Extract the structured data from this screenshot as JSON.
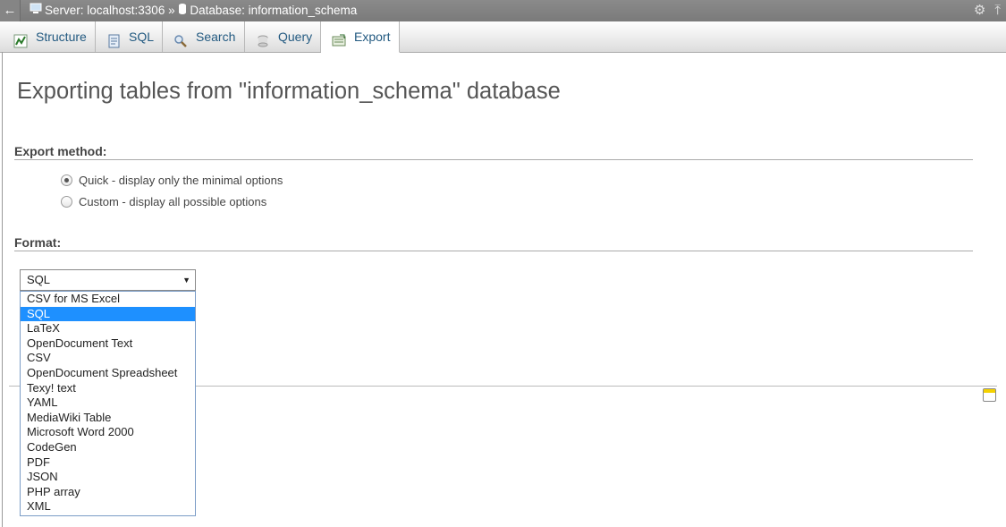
{
  "topbar": {
    "back_glyph": "←",
    "server_label": "Server: localhost:3306",
    "separator": "»",
    "database_label": "Database: information_schema",
    "icons": [
      "server-icon",
      "database-icon",
      "gear-icon",
      "collapse-icon"
    ]
  },
  "tabs": [
    {
      "label": "Structure",
      "icon": "structure-icon"
    },
    {
      "label": "SQL",
      "icon": "sql-icon"
    },
    {
      "label": "Search",
      "icon": "search-icon"
    },
    {
      "label": "Query",
      "icon": "query-icon"
    },
    {
      "label": "Export",
      "icon": "export-icon",
      "active": true
    }
  ],
  "page_title": "Exporting tables from \"information_schema\" database",
  "export_method": {
    "heading": "Export method:",
    "options": [
      {
        "label": "Quick - display only the minimal options",
        "checked": true
      },
      {
        "label": "Custom - display all possible options",
        "checked": false
      }
    ]
  },
  "format": {
    "heading": "Format:",
    "selected": "SQL",
    "options": [
      "CSV for MS Excel",
      "SQL",
      "LaTeX",
      "OpenDocument Text",
      "CSV",
      "OpenDocument Spreadsheet",
      "Texy! text",
      "YAML",
      "MediaWiki Table",
      "Microsoft Word 2000",
      "CodeGen",
      "PDF",
      "JSON",
      "PHP array",
      "XML"
    ],
    "highlighted_index": 1
  },
  "colors": {
    "topbar_bg": "#7f7f7f",
    "tab_text": "#235a81",
    "dropdown_highlight": "#1e90ff"
  }
}
